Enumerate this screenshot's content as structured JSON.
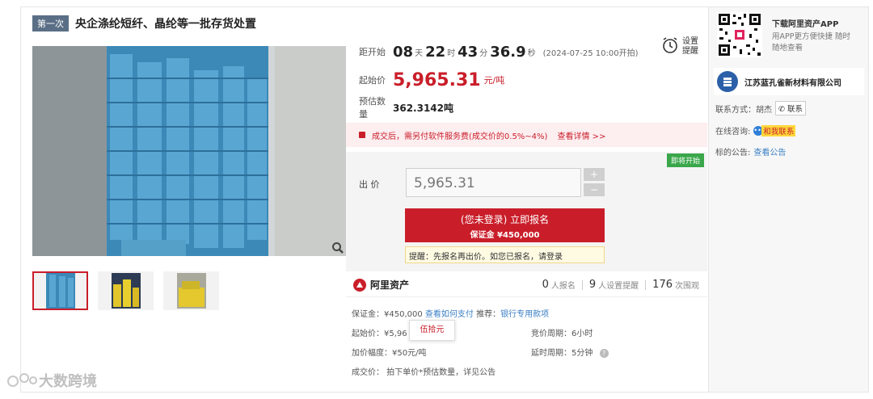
{
  "header": {
    "round_badge": "第一次",
    "title": "央企涤纶短纤、晶纶等一批存货处置"
  },
  "countdown": {
    "label": "距开始",
    "days": "08",
    "days_unit": "天",
    "hours": "22",
    "hours_unit": "时",
    "minutes": "43",
    "minutes_unit": "分",
    "seconds": "36.9",
    "seconds_unit": "秒",
    "start_time": "(2024-07-25 10:00开拍)"
  },
  "remind": {
    "label": "设置提醒",
    "icon": "alarm-clock-icon"
  },
  "start_price": {
    "label": "起始价",
    "value": "5,965.31",
    "unit": "元/吨"
  },
  "quantity": {
    "label": "预估数量",
    "value": "362.3142吨"
  },
  "notice": {
    "text": "成交后，需另付软件服务费(成交价的0.5%~4%)",
    "link": "查看详情 >>"
  },
  "bid": {
    "status_tag": "即将开始",
    "label": "出 价",
    "value": "5,965.31",
    "plus": "+",
    "minus": "−",
    "signup_line1": "(您未登录) 立即报名",
    "signup_line2": "保证金 ¥450,000",
    "tip": "提醒：先报名再出价。如您已报名，请登录"
  },
  "stats": {
    "platform": "阿里资产",
    "signups": "0",
    "signups_label": "人报名",
    "reminders": "9",
    "reminders_label": "人设置提醒",
    "views": "176",
    "views_label": "次围观"
  },
  "details": {
    "deposit": "保证金：¥450,000",
    "how_to_pay": "查看如何支付",
    "recommend": "推荐：",
    "bank_account": "银行专用款项",
    "start_price": "起始价：¥5,96",
    "increment": "加价幅度：¥50元/吨",
    "deal_price": "成交价：  拍下单价*预估数量，详见公告",
    "cycle": "竞价周期：6小时",
    "delay": "延时周期：5分钟",
    "tooltip": "伍拾元"
  },
  "right_panel": {
    "app_title": "下载阿里资产APP",
    "app_sub": "用APP更方便快捷 随时随地查看",
    "company": "江苏蓝孔雀新材料有限公司",
    "contact_label": "联系方式：胡杰",
    "contact_button": "联系",
    "consult_label": "在线咨询:",
    "consult_button": "和我联系",
    "announce_label": "标的公告:",
    "announce_link": "查看公告"
  },
  "watermark": "大数跨境",
  "colors": {
    "accent": "#c91e2a",
    "link": "#3b7fc4",
    "tag_green": "#39a74a"
  }
}
